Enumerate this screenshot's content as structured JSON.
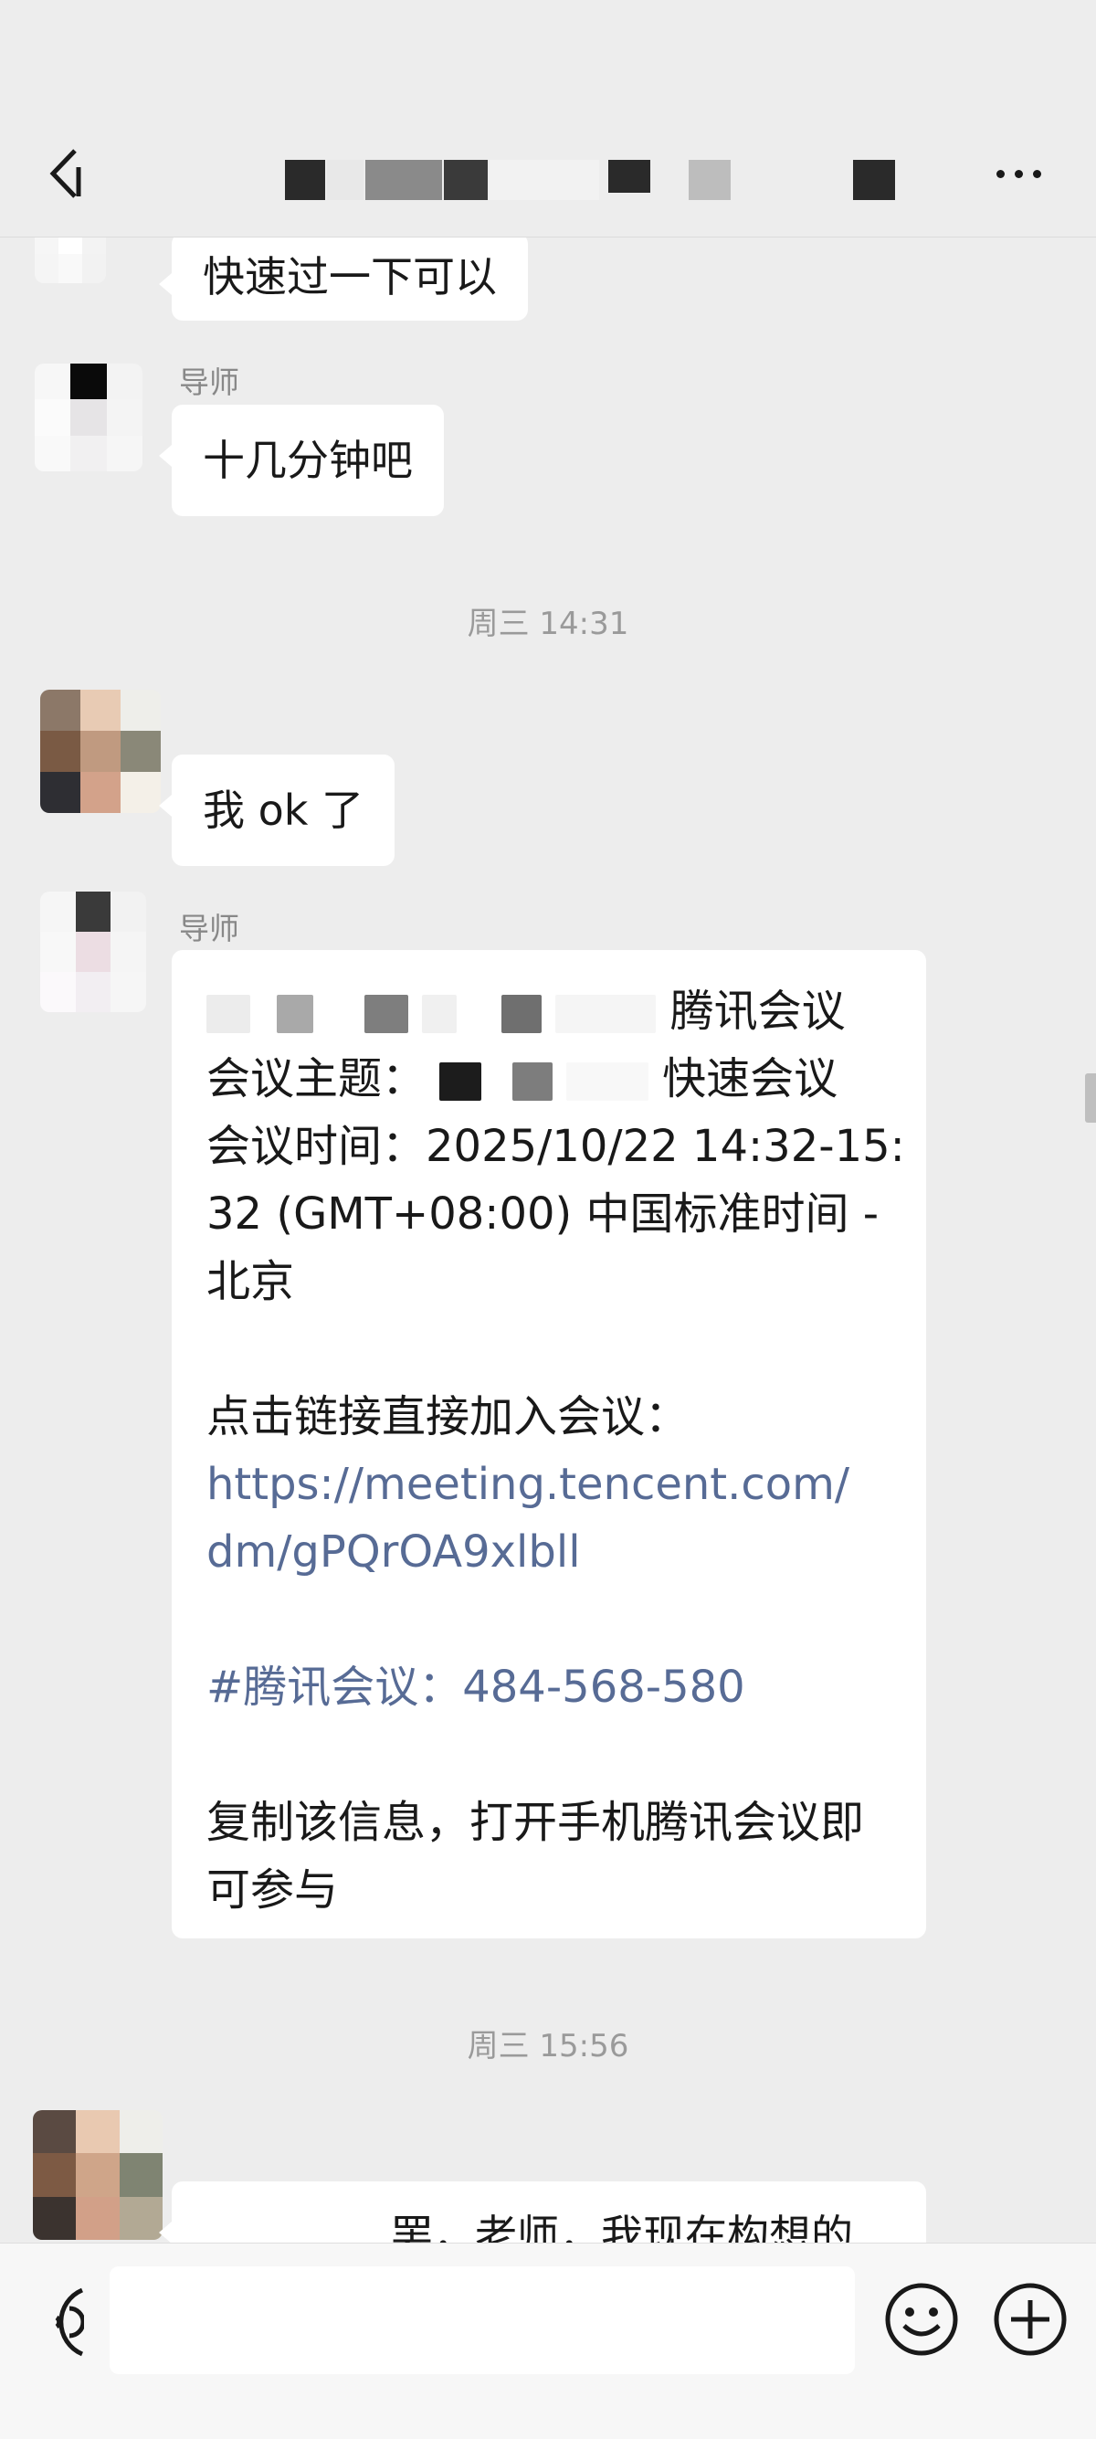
{
  "header": {
    "title": "",
    "back_icon": "chevron-left-icon",
    "more_icon": "more-dots-icon"
  },
  "messages": {
    "m1": {
      "text": "快速过一下可以"
    },
    "m2": {
      "sender": "导师",
      "text": "十几分钟吧"
    },
    "time1": "周三 14:31",
    "m3": {
      "text": "我 ok 了"
    },
    "m4": {
      "sender": "导师",
      "line1_suffix": "腾讯会议",
      "topic_label": "会议主题：",
      "topic_suffix": "快速会议",
      "time_line1": "会议时间：2025/10/22 14:32-15:",
      "time_line2": "32 (GMT+08:00) 中国标准时间 -",
      "time_line3": "北京",
      "join_label": "点击链接直接加入会议：",
      "link_line1": "https://meeting.tencent.com/",
      "link_line2": "dm/gPQrOA9xlbll",
      "meeting_id": "#腾讯会议：484-568-580",
      "copy_line1": "复制该信息，打开手机腾讯会议即",
      "copy_line2": "可参与"
    },
    "time2": "周三 15:56",
    "m5": {
      "text": "罢，老师，我现在构想的"
    }
  },
  "input": {
    "placeholder": ""
  },
  "colors": {
    "background": "#ededed",
    "bubble": "#ffffff",
    "link": "#576b95",
    "timestamp": "#9a9a9a"
  }
}
